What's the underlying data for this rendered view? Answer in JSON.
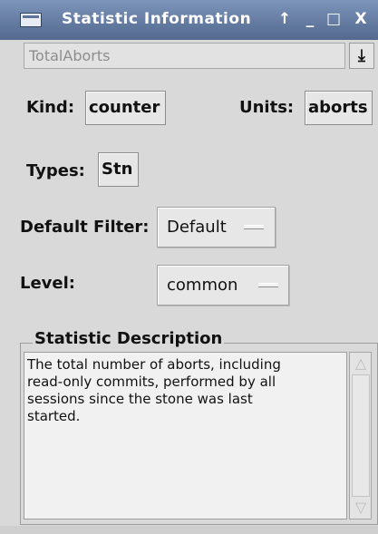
{
  "window": {
    "title": "Statistic Information",
    "controls": {
      "up": "↑",
      "minimize": "_",
      "maximize": "□",
      "close": "X"
    }
  },
  "name_field": {
    "value": "TotalAborts"
  },
  "download_glyph": "⤓",
  "fields": {
    "kind_label": "Kind:",
    "kind_value": "counter",
    "units_label": "Units:",
    "units_value": "aborts",
    "types_label": "Types:",
    "types_value": "Stn",
    "filter_label": "Default Filter:",
    "filter_value": "Default",
    "level_label": "Level:",
    "level_value": "common"
  },
  "description": {
    "title": "Statistic Description",
    "text": "The total number of aborts, including\nread-only commits, performed by all\nsessions since the stone was last\nstarted."
  },
  "scrollbar": {
    "up": "△",
    "down": "▽"
  },
  "colors": {
    "titlebar": "#6d84ad",
    "background": "#d9d9d9"
  }
}
